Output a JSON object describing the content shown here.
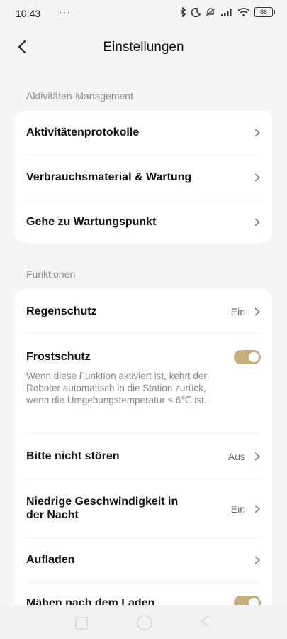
{
  "status_bar": {
    "time": "10:43",
    "dots": "···",
    "battery": "86"
  },
  "header": {
    "title": "Einstellungen"
  },
  "sections": [
    {
      "label": "Aktivitäten-Management",
      "rows": [
        {
          "title": "Aktivitätenprotokolle"
        },
        {
          "title": "Verbrauchsmaterial & Wartung"
        },
        {
          "title": "Gehe zu Wartungspunkt"
        }
      ]
    },
    {
      "label": "Funktionen",
      "rows": [
        {
          "title": "Regenschutz",
          "value": "Ein"
        },
        {
          "title": "Frostschutz",
          "description": "Wenn diese Funktion aktiviert ist, kehrt der Roboter automatisch in die Station zurück, wenn die Umgebungstemperatur ≤ 6℃ ist.",
          "toggle": true
        },
        {
          "title": "Bitte nicht stören",
          "value": "Aus"
        },
        {
          "title": "Niedrige Geschwindigkeit in der Nacht",
          "value": "Ein"
        },
        {
          "title": "Aufladen"
        },
        {
          "title": "Mähen nach dem Laden",
          "toggle": true
        }
      ]
    }
  ],
  "colors": {
    "toggle_on": "#c5ad7c",
    "background": "#f5f5f5",
    "card": "#ffffff"
  }
}
